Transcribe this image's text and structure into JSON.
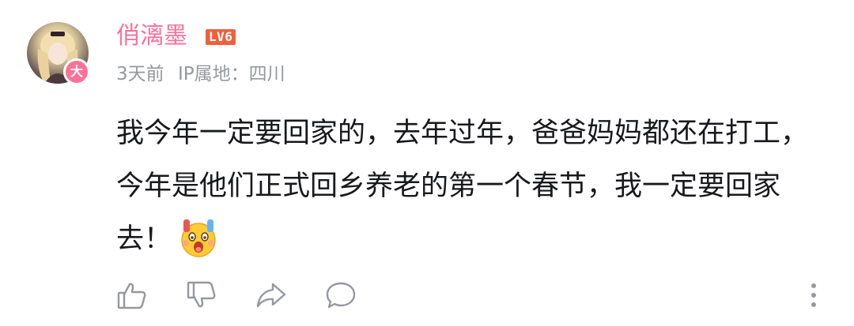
{
  "comment": {
    "user": {
      "name": "俏漓墨",
      "level": "LV6",
      "vip_badge": "大",
      "avatar_icon": "avatar-image"
    },
    "meta": {
      "time": "3天前",
      "ip_location": "IP属地：四川"
    },
    "content": "我今年一定要回家的，去年过年，爸爸妈妈都还在打工，今年是他们正式回乡养老的第一个春节，我一定要回家去！",
    "emoji": "shocked-face-emoji"
  },
  "actions": [
    {
      "name": "like-icon"
    },
    {
      "name": "dislike-icon"
    },
    {
      "name": "share-icon"
    },
    {
      "name": "reply-icon"
    }
  ],
  "colors": {
    "accent": "#fb7299",
    "level_badge": "#f0603c",
    "meta_text": "#9499a0",
    "icon": "#9499a0"
  }
}
